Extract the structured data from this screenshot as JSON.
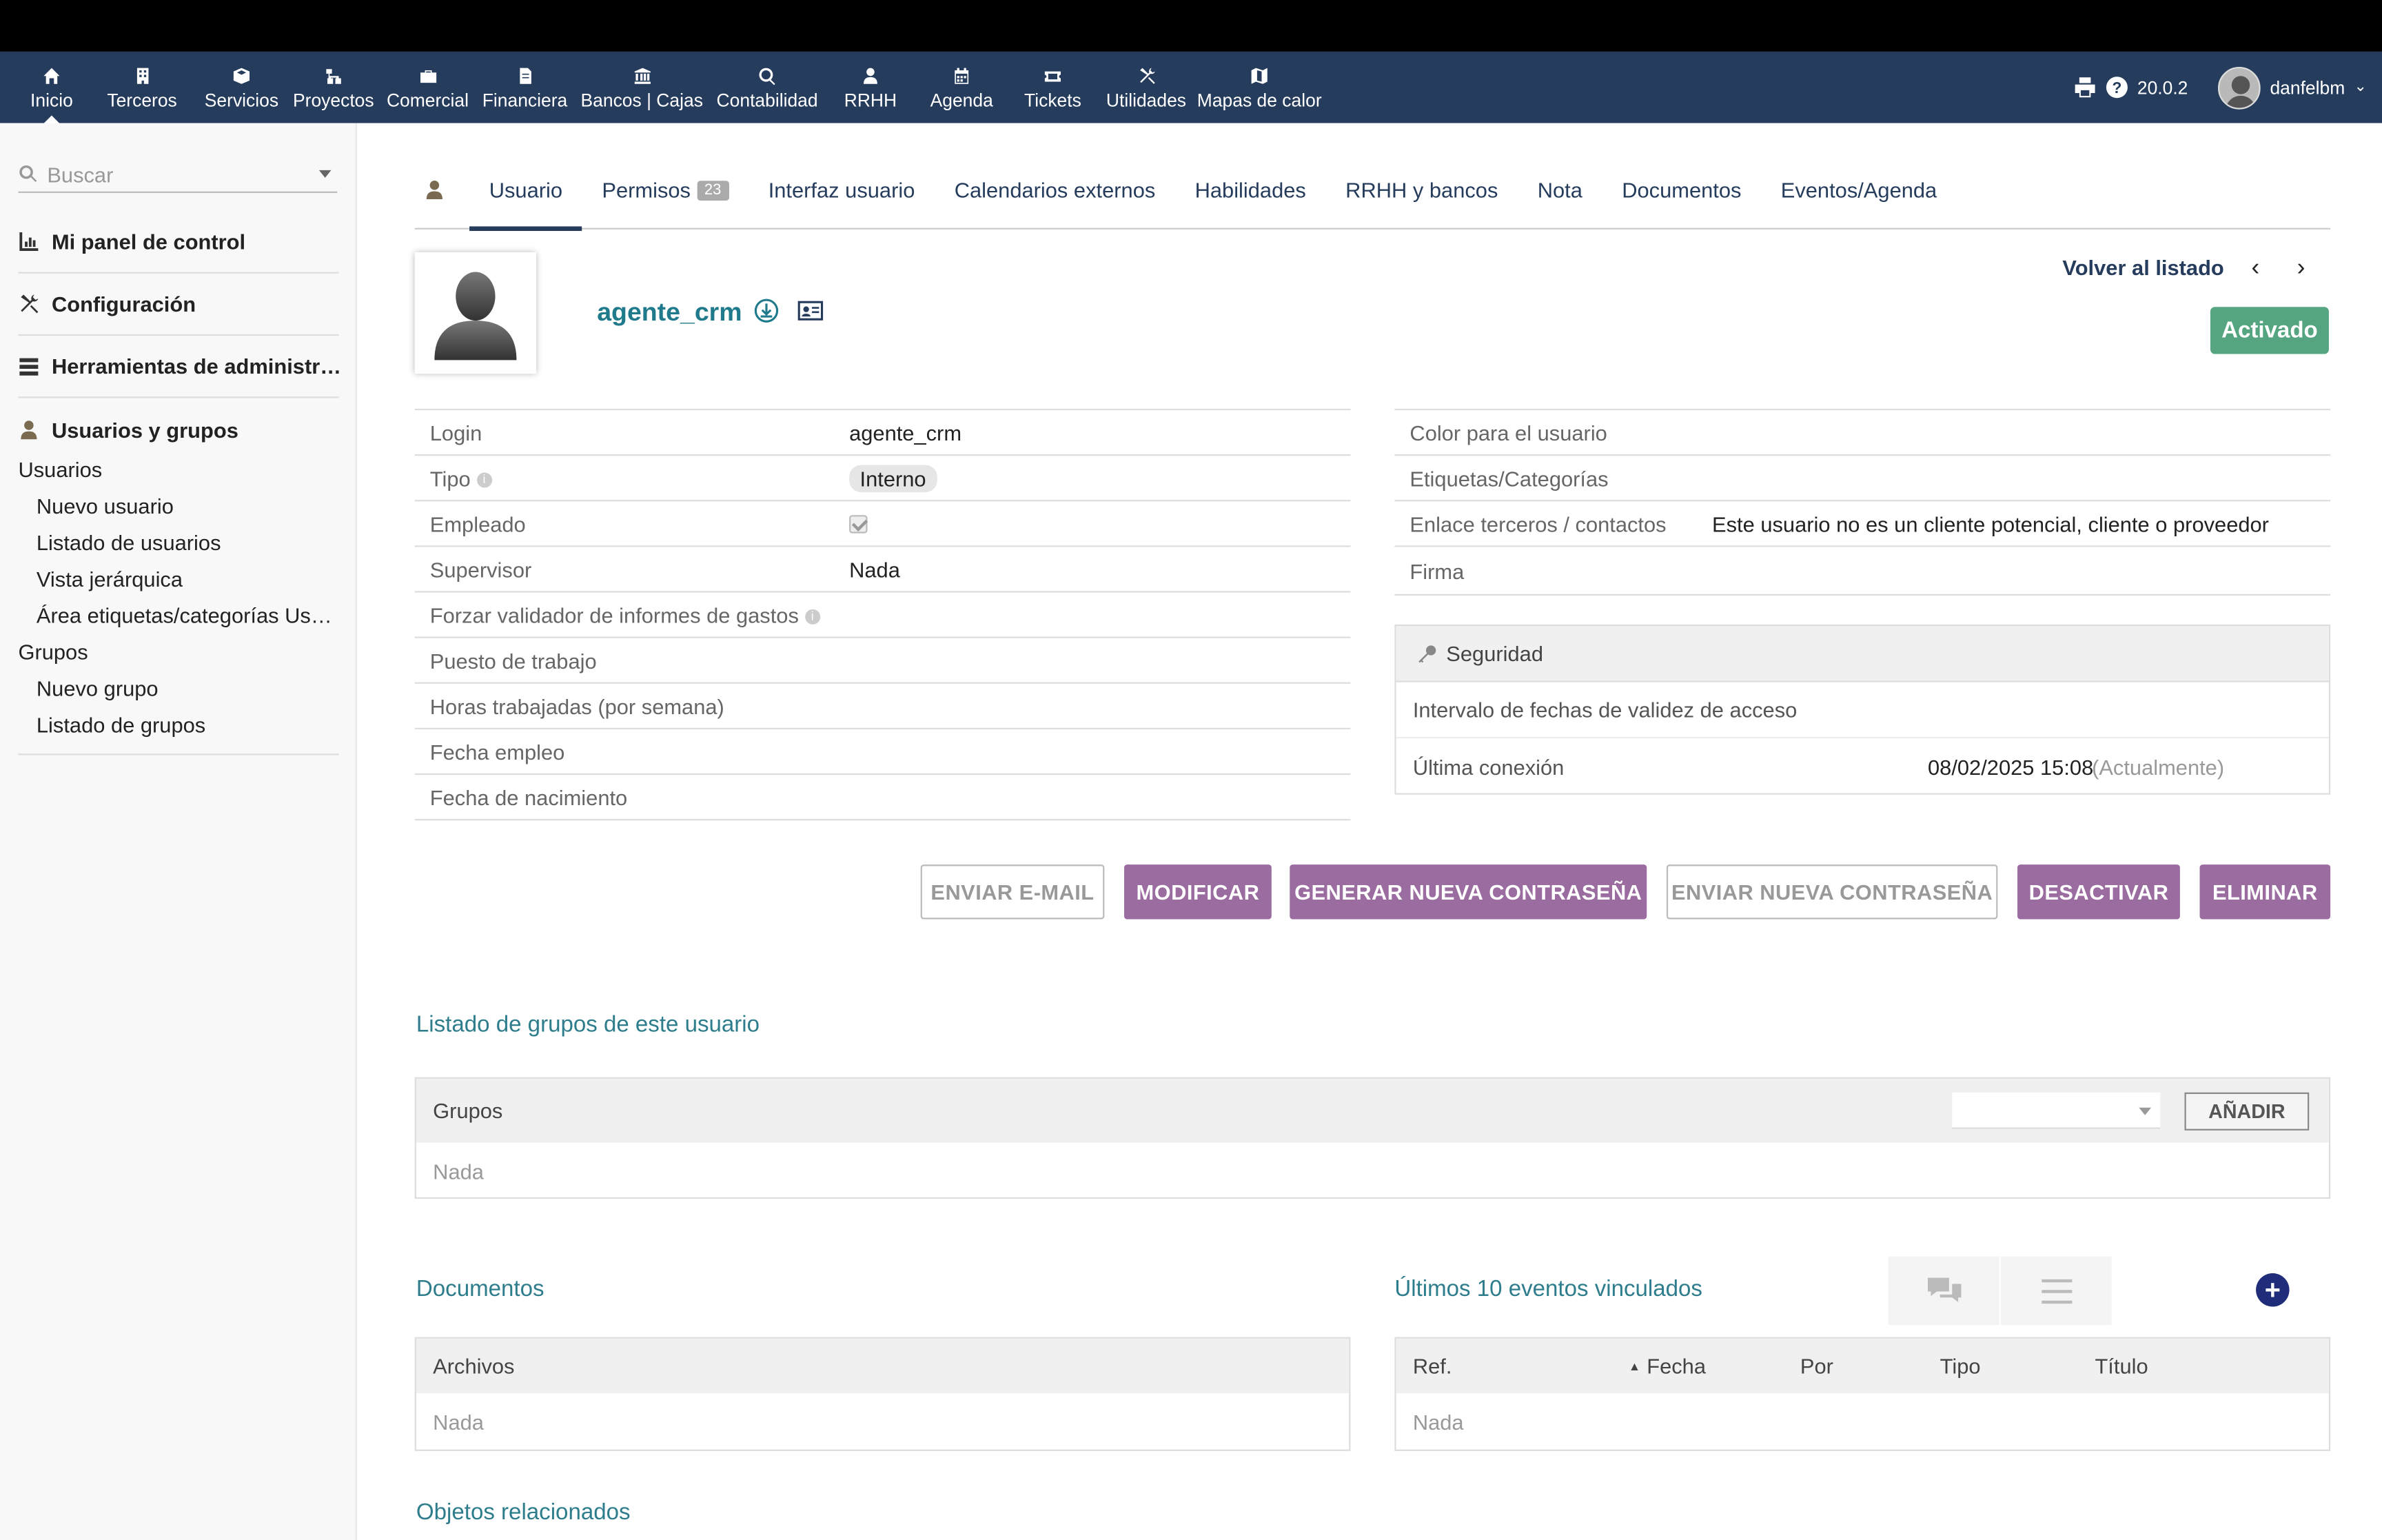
{
  "topmenu": [
    {
      "label": "Inicio",
      "icon": "home-icon",
      "active": true
    },
    {
      "label": "Terceros",
      "icon": "building-icon"
    },
    {
      "label": "Servicios",
      "icon": "cube-icon"
    },
    {
      "label": "Proyectos",
      "icon": "sitemap-icon"
    },
    {
      "label": "Comercial",
      "icon": "suitcase-icon"
    },
    {
      "label": "Financiera",
      "icon": "file-invoice-icon"
    },
    {
      "label": "Bancos | Cajas",
      "icon": "bank-icon"
    },
    {
      "label": "Contabilidad",
      "icon": "search-dollar-icon"
    },
    {
      "label": "RRHH",
      "icon": "user-tie-icon"
    },
    {
      "label": "Agenda",
      "icon": "calendar-icon"
    },
    {
      "label": "Tickets",
      "icon": "ticket-icon"
    },
    {
      "label": "Utilidades",
      "icon": "tools-icon"
    },
    {
      "label": "Mapas de calor",
      "icon": "map-icon"
    }
  ],
  "topright": {
    "version": "20.0.2",
    "username": "danfelbm"
  },
  "sidebar": {
    "search_placeholder": "Buscar",
    "blocks": [
      {
        "label": "Mi panel de control",
        "icon": "chart-icon"
      },
      {
        "label": "Configuración",
        "icon": "tools-icon"
      },
      {
        "label": "Herramientas de administr…",
        "icon": "server-icon"
      },
      {
        "label": "Usuarios y grupos",
        "icon": "user-icon"
      }
    ],
    "users_menu": {
      "usuarios": "Usuarios",
      "nuevo_usuario": "Nuevo usuario",
      "listado_usuarios": "Listado de usuarios",
      "vista_jerarquica": "Vista jerárquica",
      "area_etiquetas": "Área etiquetas/categorías Usu…",
      "grupos": "Grupos",
      "nuevo_grupo": "Nuevo grupo",
      "listado_grupos": "Listado de grupos"
    }
  },
  "tabs": {
    "usuario": "Usuario",
    "permisos": "Permisos",
    "permisos_count": "23",
    "interfaz": "Interfaz usuario",
    "calendarios": "Calendarios externos",
    "habilidades": "Habilidades",
    "rrhh": "RRHH y bancos",
    "nota": "Nota",
    "documentos": "Documentos",
    "eventos": "Eventos/Agenda"
  },
  "header": {
    "username": "agente_crm",
    "back": "Volver al listado",
    "prev": "‹",
    "next": "›",
    "status": "Activado",
    "status_color": "#55a580"
  },
  "left_fields": {
    "login_k": "Login",
    "login_v": "agente_crm",
    "tipo_k": "Tipo",
    "tipo_v": "Interno",
    "empleado_k": "Empleado",
    "supervisor_k": "Supervisor",
    "supervisor_v": "Nada",
    "forzar_k": "Forzar validador de informes de gastos",
    "puesto_k": "Puesto de trabajo",
    "horas_k": "Horas trabajadas (por semana)",
    "fecha_empleo_k": "Fecha empleo",
    "fecha_nac_k": "Fecha de nacimiento"
  },
  "right_fields": {
    "color_k": "Color para el usuario",
    "etiquetas_k": "Etiquetas/Categorías",
    "enlace_k": "Enlace terceros / contactos",
    "enlace_v": "Este usuario no es un cliente potencial, cliente o proveedor",
    "firma_k": "Firma"
  },
  "security": {
    "title": "Seguridad",
    "intervalo": "Intervalo de fechas de validez de acceso",
    "ultima_k": "Última conexión",
    "ultima_v": "08/02/2025 15:08",
    "ultima_note": "(Actualmente)"
  },
  "buttons": {
    "email": "ENVIAR E-MAIL",
    "modificar": "MODIFICAR",
    "generar": "GENERAR NUEVA CONTRASEÑA",
    "enviar_pw": "ENVIAR NUEVA CONTRASEÑA",
    "desactivar": "DESACTIVAR",
    "eliminar": "ELIMINAR",
    "purple": "#9a6ca0"
  },
  "groups": {
    "title": "Listado de grupos de este usuario",
    "col": "Grupos",
    "add": "AÑADIR",
    "empty": "Nada"
  },
  "documents": {
    "title": "Documentos",
    "col": "Archivos",
    "empty": "Nada"
  },
  "events": {
    "title": "Últimos 10 eventos vinculados",
    "cols": {
      "ref": "Ref.",
      "fecha": "Fecha",
      "por": "Por",
      "tipo": "Tipo",
      "titulo": "Título"
    },
    "empty": "Nada"
  },
  "related": {
    "title": "Objetos relacionados"
  }
}
